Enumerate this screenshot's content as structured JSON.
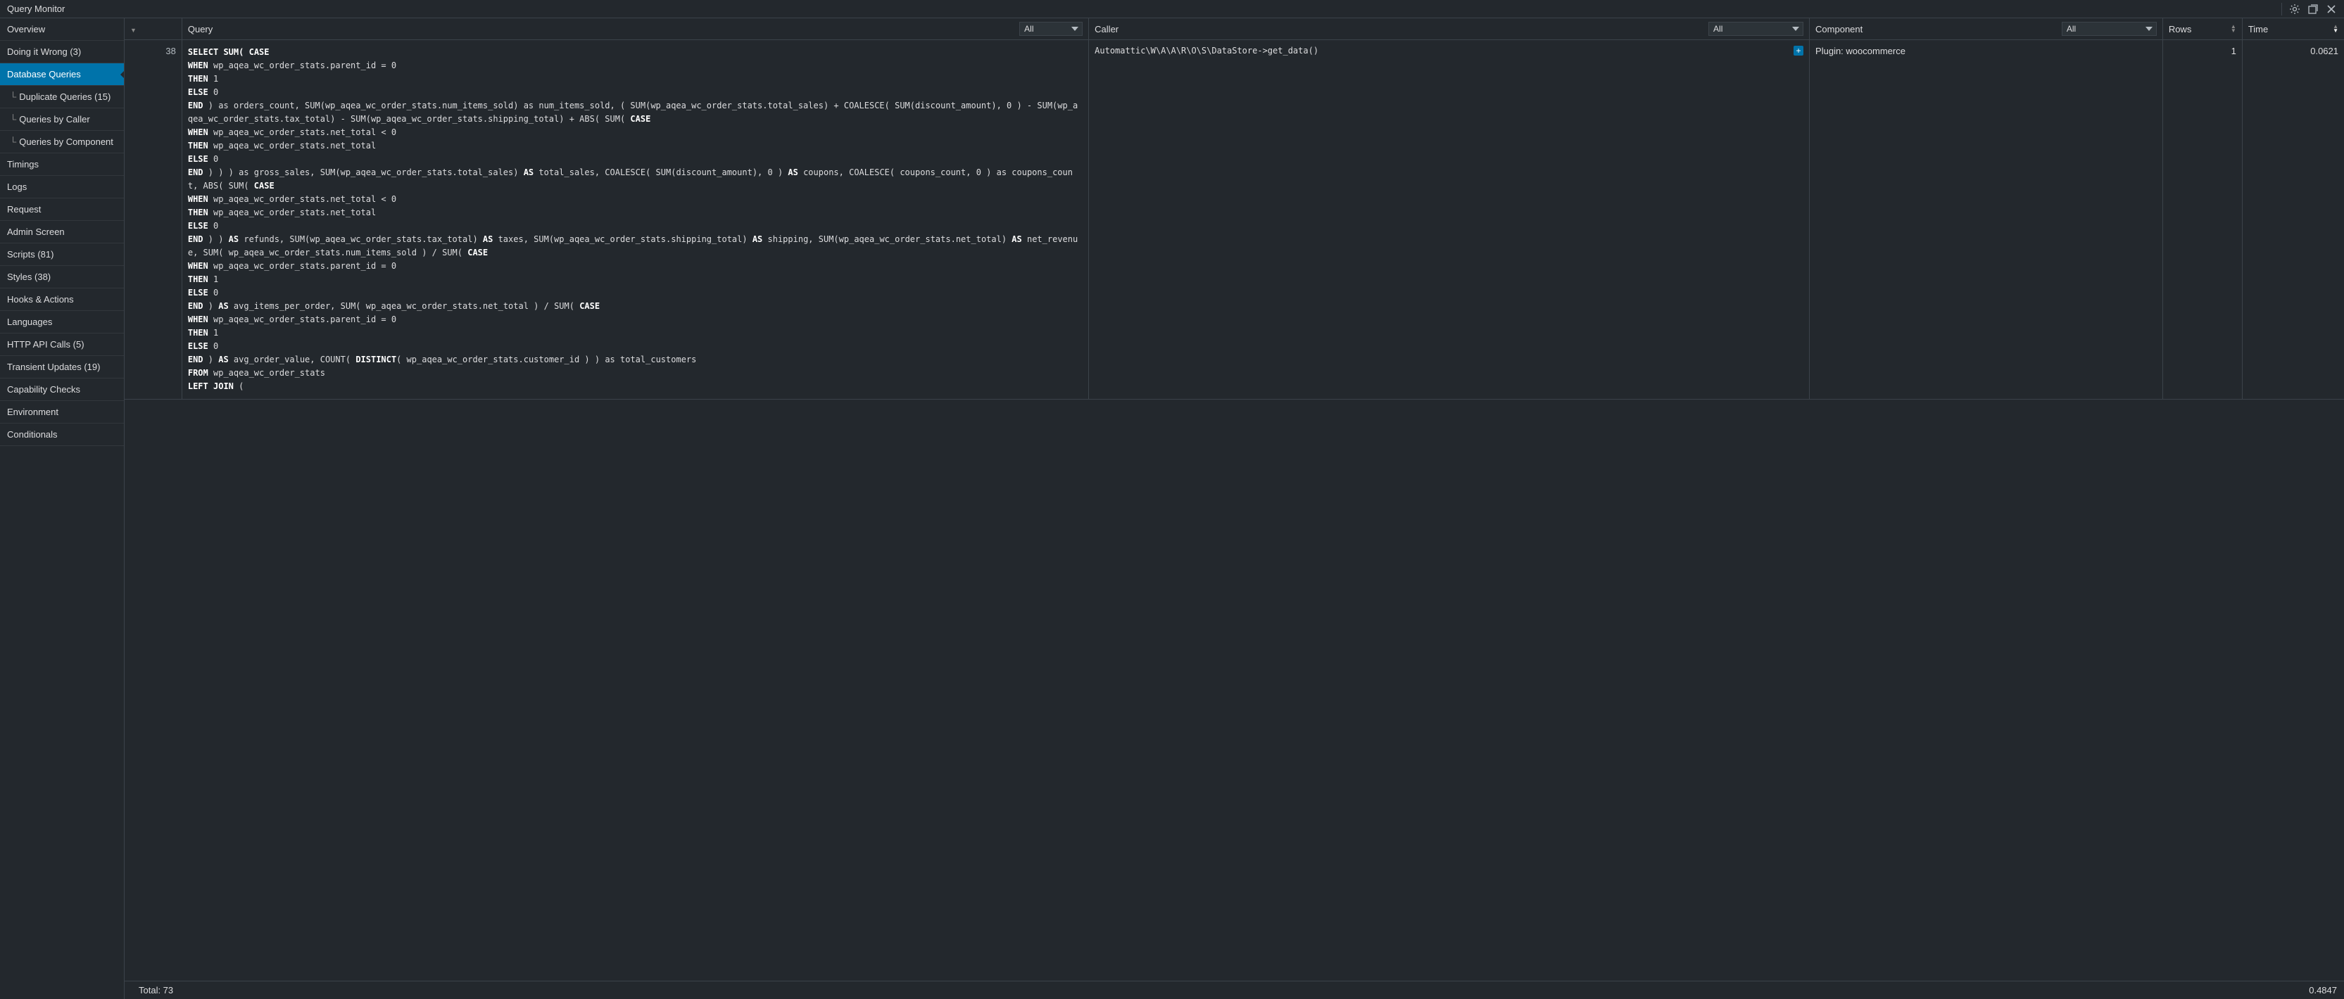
{
  "titlebar": {
    "title": "Query Monitor"
  },
  "sidebar": {
    "items": [
      {
        "label": "Overview",
        "active": false,
        "child": false
      },
      {
        "label": "Doing it Wrong (3)",
        "active": false,
        "child": false
      },
      {
        "label": "Database Queries",
        "active": true,
        "child": false
      },
      {
        "label": "Duplicate Queries (15)",
        "active": false,
        "child": true
      },
      {
        "label": "Queries by Caller",
        "active": false,
        "child": true
      },
      {
        "label": "Queries by Component",
        "active": false,
        "child": true
      },
      {
        "label": "Timings",
        "active": false,
        "child": false
      },
      {
        "label": "Logs",
        "active": false,
        "child": false
      },
      {
        "label": "Request",
        "active": false,
        "child": false
      },
      {
        "label": "Admin Screen",
        "active": false,
        "child": false
      },
      {
        "label": "Scripts (81)",
        "active": false,
        "child": false
      },
      {
        "label": "Styles (38)",
        "active": false,
        "child": false
      },
      {
        "label": "Hooks & Actions",
        "active": false,
        "child": false
      },
      {
        "label": "Languages",
        "active": false,
        "child": false
      },
      {
        "label": "HTTP API Calls (5)",
        "active": false,
        "child": false
      },
      {
        "label": "Transient Updates (19)",
        "active": false,
        "child": false
      },
      {
        "label": "Capability Checks",
        "active": false,
        "child": false
      },
      {
        "label": "Environment",
        "active": false,
        "child": false
      },
      {
        "label": "Conditionals",
        "active": false,
        "child": false
      }
    ]
  },
  "columns": {
    "num_label": "",
    "query_label": "Query",
    "caller_label": "Caller",
    "component_label": "Component",
    "rows_label": "Rows",
    "time_label": "Time"
  },
  "filters": {
    "query": "All",
    "caller": "All",
    "component": "All"
  },
  "row": {
    "num": "38",
    "sql_lines": [
      {
        "t": "SELECT SUM( CASE",
        "k": [
          "SELECT",
          "SUM(",
          "CASE"
        ]
      },
      {
        "t": "WHEN wp_aqea_wc_order_stats.parent_id = 0",
        "k": [
          "WHEN"
        ]
      },
      {
        "t": "THEN 1",
        "k": [
          "THEN"
        ]
      },
      {
        "t": "ELSE 0",
        "k": [
          "ELSE"
        ]
      },
      {
        "t": "END ) as orders_count, SUM(wp_aqea_wc_order_stats.num_items_sold) as num_items_sold, ( SUM(wp_aqea_wc_order_stats.total_sales) + COALESCE( SUM(discount_amount), 0 ) - SUM(wp_aqea_wc_order_stats.tax_total) - SUM(wp_aqea_wc_order_stats.shipping_total) + ABS( SUM( CASE",
        "k": [
          "END",
          "CASE"
        ]
      },
      {
        "t": "WHEN wp_aqea_wc_order_stats.net_total < 0",
        "k": [
          "WHEN"
        ]
      },
      {
        "t": "THEN wp_aqea_wc_order_stats.net_total",
        "k": [
          "THEN"
        ]
      },
      {
        "t": "ELSE 0",
        "k": [
          "ELSE"
        ]
      },
      {
        "t": "END ) ) ) as gross_sales, SUM(wp_aqea_wc_order_stats.total_sales) AS total_sales, COALESCE( SUM(discount_amount), 0 ) AS coupons, COALESCE( coupons_count, 0 ) as coupons_count, ABS( SUM( CASE",
        "k": [
          "END",
          "AS",
          "CASE"
        ]
      },
      {
        "t": "WHEN wp_aqea_wc_order_stats.net_total < 0",
        "k": [
          "WHEN"
        ]
      },
      {
        "t": "THEN wp_aqea_wc_order_stats.net_total",
        "k": [
          "THEN"
        ]
      },
      {
        "t": "ELSE 0",
        "k": [
          "ELSE"
        ]
      },
      {
        "t": "END ) ) AS refunds, SUM(wp_aqea_wc_order_stats.tax_total) AS taxes, SUM(wp_aqea_wc_order_stats.shipping_total) AS shipping, SUM(wp_aqea_wc_order_stats.net_total) AS net_revenue, SUM( wp_aqea_wc_order_stats.num_items_sold ) / SUM( CASE",
        "k": [
          "END",
          "AS",
          "CASE"
        ]
      },
      {
        "t": "WHEN wp_aqea_wc_order_stats.parent_id = 0",
        "k": [
          "WHEN"
        ]
      },
      {
        "t": "THEN 1",
        "k": [
          "THEN"
        ]
      },
      {
        "t": "ELSE 0",
        "k": [
          "ELSE"
        ]
      },
      {
        "t": "END ) AS avg_items_per_order, SUM( wp_aqea_wc_order_stats.net_total ) / SUM( CASE",
        "k": [
          "END",
          "AS",
          "CASE"
        ]
      },
      {
        "t": "WHEN wp_aqea_wc_order_stats.parent_id = 0",
        "k": [
          "WHEN"
        ]
      },
      {
        "t": "THEN 1",
        "k": [
          "THEN"
        ]
      },
      {
        "t": "ELSE 0",
        "k": [
          "ELSE"
        ]
      },
      {
        "t": "END ) AS avg_order_value, COUNT( DISTINCT( wp_aqea_wc_order_stats.customer_id ) ) as total_customers",
        "k": [
          "END",
          "AS",
          "DISTINCT"
        ]
      },
      {
        "t": "FROM wp_aqea_wc_order_stats",
        "k": [
          "FROM"
        ]
      },
      {
        "t": "LEFT JOIN (",
        "k": [
          "LEFT",
          "JOIN"
        ]
      }
    ],
    "caller": "Automattic\\W\\A\\A\\R\\O\\S\\DataStore->get_data()",
    "component": "Plugin: woocommerce",
    "rows": "1",
    "time": "0.0621"
  },
  "footer": {
    "total_label": "Total: 73",
    "time_total": "0.4847"
  }
}
